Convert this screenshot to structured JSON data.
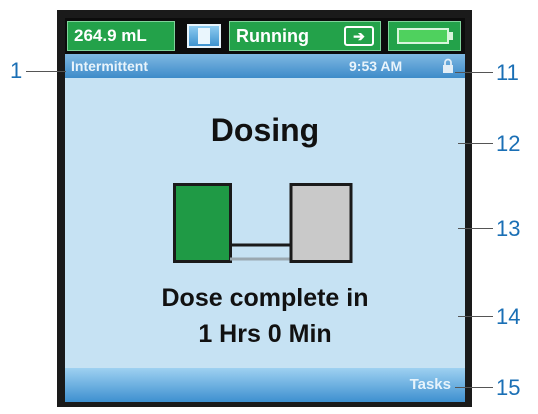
{
  "status_bar": {
    "volume": "264.9 mL",
    "bag_icon": "iv-bag-icon",
    "state": "Running",
    "flow_icon": "flow-arrow-icon",
    "battery_icon": "battery-icon",
    "battery_level": 1.0
  },
  "mode_bar": {
    "mode": "Intermittent",
    "time": "9:53 AM",
    "lock_icon": "lock-icon"
  },
  "main": {
    "title": "Dosing",
    "dose_graphic": "dose-progress-graphic",
    "message_line1": "Dose complete in",
    "message_line2": "1 Hrs 0 Min"
  },
  "softkeys": {
    "right": "Tasks"
  },
  "callouts": [
    "1",
    "11",
    "12",
    "13",
    "14",
    "15"
  ],
  "colors": {
    "status_green": "#23a24a",
    "screen_bg": "#c6e2f3",
    "bar_blue": "#3d8bc9",
    "dose_green": "#1f9a45",
    "dose_gray": "#c9c9c9",
    "callout_blue": "#1a6fb5"
  }
}
